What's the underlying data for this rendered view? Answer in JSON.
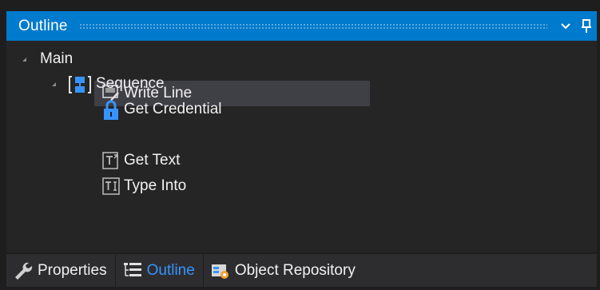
{
  "panel": {
    "title": "Outline"
  },
  "tree": {
    "root": {
      "label": "Main"
    },
    "sequence": {
      "label": "Sequence"
    },
    "activities": [
      {
        "label": "Get Credential",
        "icon": "lock-icon"
      },
      {
        "label": "Write Line",
        "icon": "write-line-icon",
        "selected": true
      },
      {
        "label": "Get Text",
        "icon": "get-text-icon"
      },
      {
        "label": "Type Into",
        "icon": "type-into-icon"
      }
    ]
  },
  "tabs": [
    {
      "label": "Properties",
      "icon": "wrench-icon"
    },
    {
      "label": "Outline",
      "icon": "outline-icon",
      "active": true
    },
    {
      "label": "Object Repository",
      "icon": "object-repository-icon"
    }
  ],
  "colors": {
    "accent": "#007acc",
    "active_tab": "#3794ff",
    "selection": "#3f3f46",
    "background": "#252526"
  }
}
